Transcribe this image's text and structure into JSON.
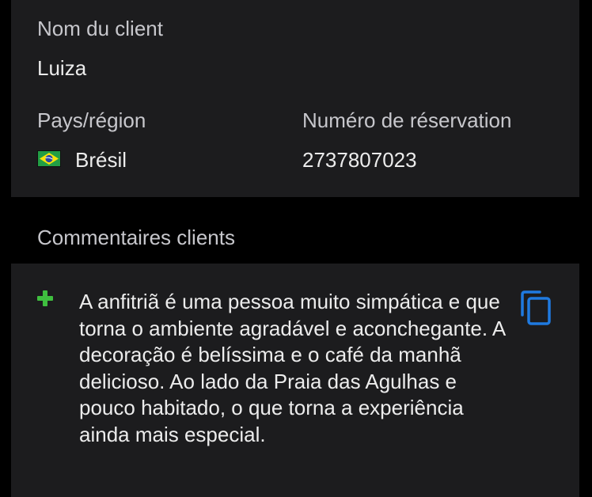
{
  "client": {
    "name_label": "Nom du client",
    "name_value": "Luiza",
    "country_label": "Pays/région",
    "country_value": "Brésil",
    "country_flag_icon": "brazil-flag-icon",
    "reservation_label": "Numéro de réservation",
    "reservation_value": "2737807023"
  },
  "comments": {
    "header": "Commentaires clients",
    "positive_icon": "plus-icon",
    "text": "A anfitriã é uma pessoa muito simpática e que torna o ambiente agradável e aconchegante. A decoração é belíssima e o café da manhã delicioso. Ao lado da Praia das Agulhas e pouco habitado, o que torna a experiência ainda mais especial.",
    "copy_icon": "copy-icon"
  },
  "colors": {
    "background": "#000000",
    "card": "#1c1c1e",
    "label": "#c7c7cc",
    "text": "#ececec",
    "positive": "#3fbf3f",
    "accent": "#1f7ae0"
  }
}
